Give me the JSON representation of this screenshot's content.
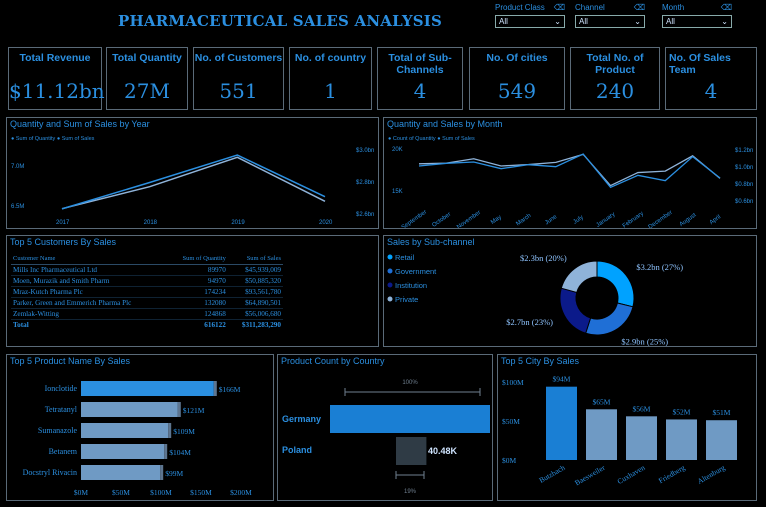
{
  "title": "PHARMACEUTICAL SALES ANALYSIS",
  "slicers": [
    {
      "label": "Product Class",
      "value": "All"
    },
    {
      "label": "Channel",
      "value": "All"
    },
    {
      "label": "Month",
      "value": "All"
    }
  ],
  "kpis": [
    {
      "label": "Total Revenue",
      "value": "$11.12bn"
    },
    {
      "label": "Total Quantity",
      "value": "27M"
    },
    {
      "label": "No. of Customers",
      "value": "551"
    },
    {
      "label": "No. of country",
      "value": "1"
    },
    {
      "label": "Total of Sub-Channels",
      "value": "4"
    },
    {
      "label": "No. Of cities",
      "value": "549"
    },
    {
      "label": "Total No. of Product",
      "value": "240"
    },
    {
      "label": "No. Of Sales Team",
      "value": "4"
    }
  ],
  "colors": {
    "accent": "#2b8fe0",
    "line_light": "#8fb3d9",
    "bar_gray": "#6f9ac4",
    "border": "#5a6a78"
  },
  "chart_data": [
    {
      "type": "line",
      "title": "Quantity and Sum of Sales by Year",
      "legend": [
        "Sum of Quantity",
        "Sum of Sales"
      ],
      "categories": [
        "2017",
        "2018",
        "2019",
        "2020"
      ],
      "series": [
        {
          "name": "Sum of Quantity",
          "values": [
            6.0,
            6.6,
            7.4,
            6.2
          ],
          "axis": "left"
        },
        {
          "name": "Sum of Sales",
          "values": [
            2.52,
            2.78,
            3.05,
            2.64
          ],
          "axis": "right"
        }
      ],
      "y_left_ticks": [
        "7.0M",
        "6.5M"
      ],
      "y_right_ticks": [
        "$3.0bn",
        "$2.8bn",
        "$2.6bn"
      ]
    },
    {
      "type": "line",
      "title": "Quantity and Sales by Month",
      "legend": [
        "Count of Quantity",
        "Sum of Sales"
      ],
      "categories": [
        "September",
        "October",
        "November",
        "May",
        "March",
        "June",
        "July",
        "January",
        "February",
        "December",
        "August",
        "April"
      ],
      "series": [
        {
          "name": "Count of Quantity",
          "values": [
            18.6,
            18.7,
            19.3,
            18.3,
            18.5,
            18.8,
            19.9,
            15.6,
            17.4,
            17.6,
            19.7,
            16.6
          ]
        },
        {
          "name": "Sum of Sales",
          "values": [
            0.96,
            1.0,
            1.02,
            0.92,
            0.98,
            0.95,
            1.14,
            0.64,
            0.82,
            0.74,
            1.1,
            0.78
          ]
        }
      ],
      "y_left_ticks": [
        "20K",
        "15K"
      ],
      "y_right_ticks": [
        "$1.2bn",
        "$1.0bn",
        "$0.8bn",
        "$0.6bn"
      ]
    },
    {
      "type": "table",
      "title": "Top 5 Customers By Sales",
      "columns": [
        "Customer Name",
        "Sum of Quantity",
        "Sum of Sales"
      ],
      "rows": [
        [
          "Mills Inc Pharmaceutical Ltd",
          "89970",
          "$45,939,009"
        ],
        [
          "Moen, Murazik and Smith Pharm",
          "94970",
          "$50,885,320"
        ],
        [
          "Mraz-Kutch Pharma Plc",
          "174234",
          "$93,561,780"
        ],
        [
          "Parker, Green and Emmerich Pharma Plc",
          "132080",
          "$64,890,501"
        ],
        [
          "Zemlak-Witting",
          "124868",
          "$56,006,680"
        ]
      ],
      "total": [
        "Total",
        "616122",
        "$311,283,290"
      ]
    },
    {
      "type": "pie",
      "title": "Sales by Sub-channel",
      "legend": [
        "Retail",
        "Government",
        "Institution",
        "Private"
      ],
      "slices": [
        {
          "name": "Retail",
          "value": 3.2,
          "label": "$3.2bn (27%)",
          "color": "#00a2ff"
        },
        {
          "name": "Government",
          "value": 2.9,
          "label": "$2.9bn (25%)",
          "color": "#1f6fd6"
        },
        {
          "name": "Institution",
          "value": 2.7,
          "label": "$2.7bn (23%)",
          "color": "#0b1a8a"
        },
        {
          "name": "Private",
          "value": 2.3,
          "label": "$2.3bn (20%)",
          "color": "#8fb3d9"
        }
      ]
    },
    {
      "type": "bar",
      "title": "Top 5 Product Name By Sales",
      "categories": [
        "Ionclotide",
        "Tetratanyl",
        "Sumanazole",
        "Betanem",
        "Docstryl Rivacin"
      ],
      "values": [
        166,
        121,
        109,
        104,
        99
      ],
      "labels": [
        "$166M",
        "$121M",
        "$109M",
        "$104M",
        "$99M"
      ],
      "x_ticks": [
        "$0M",
        "$50M",
        "$100M",
        "$150M",
        "$200M"
      ],
      "xlim": [
        0,
        200
      ]
    },
    {
      "type": "bar",
      "title": "Product Count by Country",
      "categories": [
        "Germany",
        "Poland"
      ],
      "values": [
        100,
        19
      ],
      "labels": [
        "",
        "40.48K"
      ],
      "annotations": [
        "100%",
        "19%"
      ]
    },
    {
      "type": "bar",
      "title": "Top 5 City By Sales",
      "categories": [
        "Butzbach",
        "Baesweiler",
        "Cuxhaven",
        "Friedberg",
        "Altenburg"
      ],
      "values": [
        94,
        65,
        56,
        52,
        51
      ],
      "labels": [
        "$94M",
        "$65M",
        "$56M",
        "$52M",
        "$51M"
      ],
      "y_ticks": [
        "$100M",
        "$50M",
        "$0M"
      ],
      "ylim": [
        0,
        100
      ]
    }
  ]
}
